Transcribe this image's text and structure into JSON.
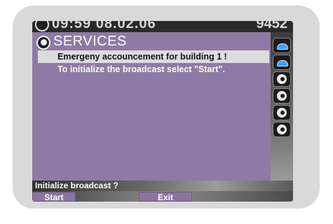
{
  "status": {
    "time": "09:59 08.02.06",
    "extension": "9452"
  },
  "service": {
    "title": "SERVICES",
    "lines": [
      "Emergeny accouncement for building 1 !",
      "To initialize the broadcast select \"Start\"."
    ]
  },
  "side_icons": [
    "phone-icon",
    "phone-icon",
    "globe-icon",
    "globe-icon",
    "globe-icon",
    "globe-icon"
  ],
  "prompt": "Initialize broadcast ?",
  "softkeys": {
    "start": "Start",
    "exit": "Exit"
  },
  "colors": {
    "content_bg": "#8f7aa6",
    "selection_bg": "#dcdcdc",
    "softkey_bg": "#8b759f"
  }
}
